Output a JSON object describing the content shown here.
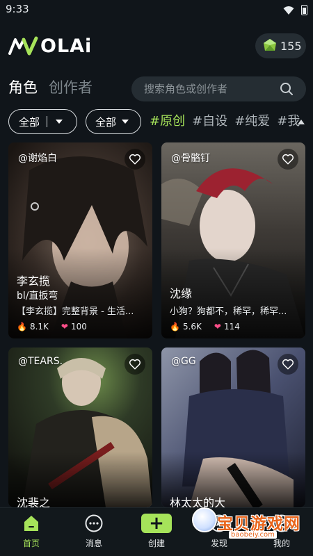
{
  "status_bar": {
    "time": "9:33"
  },
  "header": {
    "logo_text": "OLAi",
    "coins": "155"
  },
  "tabs": [
    {
      "label": "角色",
      "active": true
    },
    {
      "label": "创作者",
      "active": false
    }
  ],
  "search": {
    "placeholder": "搜索角色或创作者"
  },
  "filters": {
    "filter1_label": "全部",
    "filter2_label": "全部",
    "hashtags": [
      "#原创",
      "#自设",
      "#纯爱",
      "#我"
    ]
  },
  "cards": [
    {
      "author": "@谢焰白",
      "title": "李玄揽",
      "subtitle": "bl/直扳弯",
      "desc": "【李玄揽】完整背景 - 生活...",
      "heat": "8.1K",
      "likes": "100"
    },
    {
      "author": "@骨骼钉",
      "title": "沈缘",
      "desc": "小狗？狗都不，稀罕，稀罕...",
      "heat": "5.6K",
      "likes": "114"
    },
    {
      "author": "@TEARS.",
      "title": "沈裴之"
    },
    {
      "author": "@GG",
      "title": "林太太的大"
    }
  ],
  "bottom_nav": [
    {
      "label": "首页",
      "icon": "home-icon",
      "active": true
    },
    {
      "label": "消息",
      "icon": "message-icon",
      "active": false
    },
    {
      "label": "创建",
      "icon": "create-plus-icon",
      "active": false
    },
    {
      "label": "发现",
      "icon": "discover-icon",
      "active": false
    },
    {
      "label": "我的",
      "icon": "profile-icon",
      "active": false
    }
  ],
  "watermark": {
    "text": "宝贝游戏网",
    "url": "baobeiy.com"
  },
  "colors": {
    "accent": "#a6e35a",
    "background": "#10151a",
    "surface": "#252d33"
  }
}
